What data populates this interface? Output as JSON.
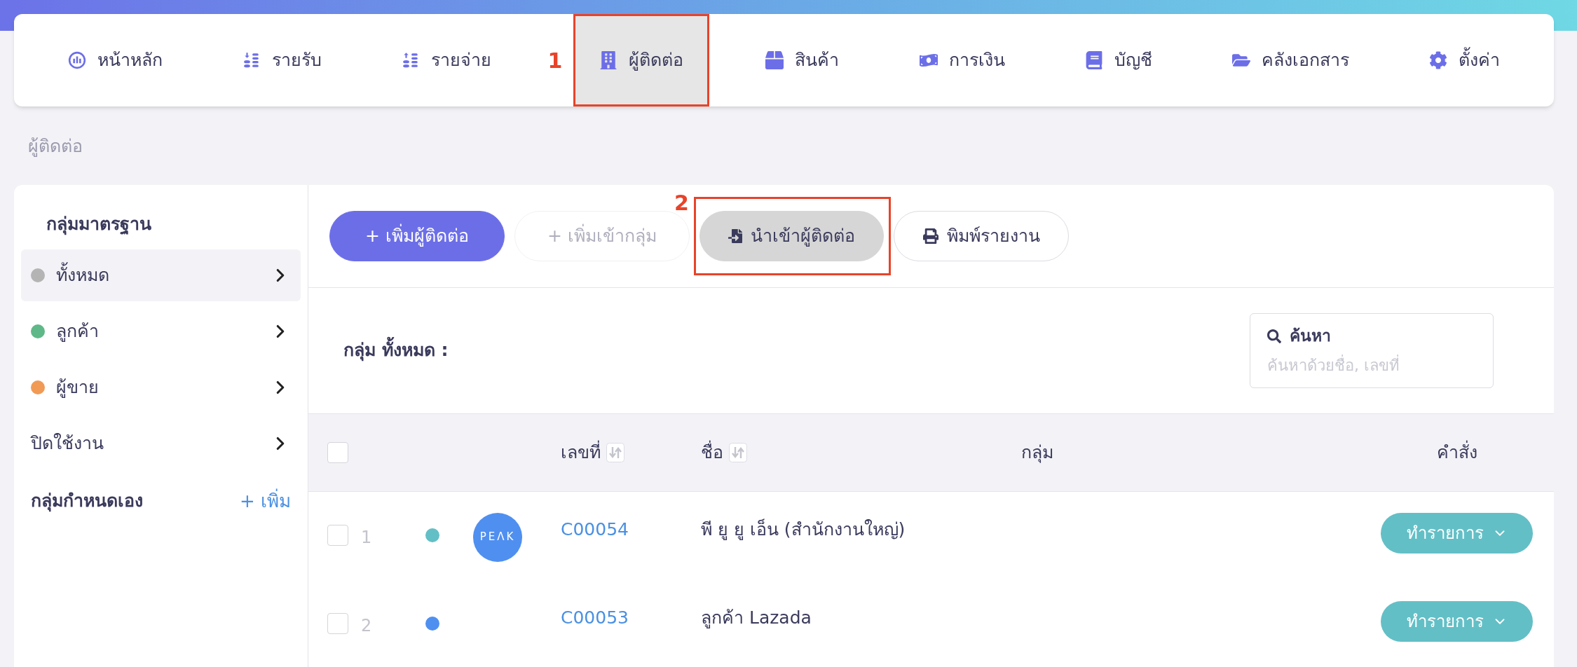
{
  "nav": {
    "items": [
      {
        "label": "หน้าหลัก",
        "selected": false
      },
      {
        "label": "รายรับ",
        "selected": false
      },
      {
        "label": "รายจ่าย",
        "selected": false
      },
      {
        "label": "ผู้ติดต่อ",
        "selected": true,
        "marker": "1"
      },
      {
        "label": "สินค้า",
        "selected": false
      },
      {
        "label": "การเงิน",
        "selected": false
      },
      {
        "label": "บัญชี",
        "selected": false
      },
      {
        "label": "คลังเอกสาร",
        "selected": false
      },
      {
        "label": "ตั้งค่า",
        "selected": false
      }
    ]
  },
  "breadcrumb": "ผู้ติดต่อ",
  "sidebar": {
    "standard_title": "กลุ่มมาตรฐาน",
    "items": [
      {
        "label": "ทั้งหมด",
        "color": "#b4b4b4",
        "selected": true
      },
      {
        "label": "ลูกค้า",
        "color": "#5fb888",
        "selected": false
      },
      {
        "label": "ผู้ขาย",
        "color": "#f09a56",
        "selected": false
      },
      {
        "label": "ปิดใช้งาน",
        "selected": false
      }
    ],
    "custom_title": "กลุ่มกำหนดเอง",
    "custom_add": "+ เพิ่ม"
  },
  "toolbar": {
    "buttons": [
      {
        "label": "+ เพิ่มผู้ติดต่อ",
        "kind": "primary",
        "disabled": false
      },
      {
        "label": "+ เพิ่มเข้ากลุ่ม",
        "kind": "outline",
        "disabled": true
      },
      {
        "label": "นำเข้าผู้ติดต่อ",
        "kind": "import",
        "disabled": false,
        "marker": "2"
      },
      {
        "label": "พิมพ์รายงาน",
        "kind": "print",
        "disabled": false
      }
    ]
  },
  "group_heading": "กลุ่ม ทั้งหมด :",
  "search": {
    "label": "ค้นหา",
    "placeholder": "ค้นหาด้วยชื่อ, เลขที่"
  },
  "table": {
    "select_all_checked": false,
    "columns": [
      {
        "label": "เลขที่",
        "sortable": true
      },
      {
        "label": "ชื่อ",
        "sortable": true
      },
      {
        "label": "กลุ่ม",
        "sortable": false
      },
      {
        "label": "คำสั่ง",
        "sortable": false
      }
    ],
    "rows": [
      {
        "index": "1",
        "checked": false,
        "color": "#63bfc6",
        "avatar": "PEΛK",
        "code": "C00054",
        "name": "พี ยู ยู เอ็น (สำนักงานใหญ่)",
        "action": "ทำรายการ"
      },
      {
        "index": "2",
        "checked": false,
        "color": "#4f8ff0",
        "code": "C00053",
        "name": "ลูกค้า Lazada",
        "action": "ทำรายการ"
      }
    ]
  }
}
